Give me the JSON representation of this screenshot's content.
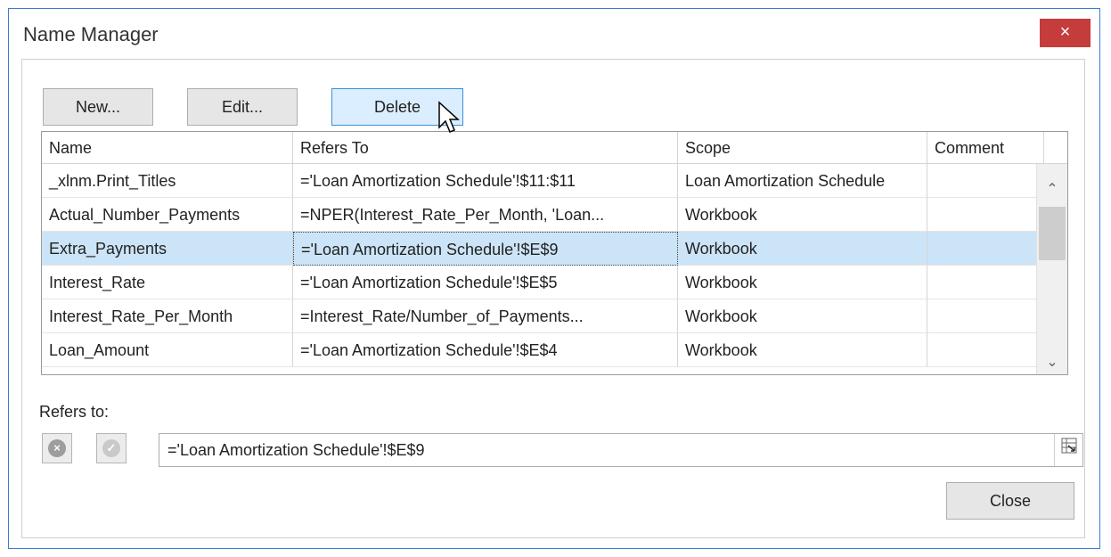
{
  "dialog": {
    "title": "Name Manager",
    "close_icon": "×"
  },
  "toolbar": {
    "new_label": "New...",
    "edit_label": "Edit...",
    "delete_label": "Delete"
  },
  "grid": {
    "headers": [
      "Name",
      "Refers To",
      "Scope",
      "Comment"
    ],
    "rows": [
      {
        "name": "_xlnm.Print_Titles",
        "refers": "='Loan Amortization Schedule'!$11:$11",
        "scope": "Loan Amortization Schedule",
        "comment": ""
      },
      {
        "name": "Actual_Number_Payments",
        "refers": "=NPER(Interest_Rate_Per_Month, 'Loan...",
        "scope": "Workbook",
        "comment": ""
      },
      {
        "name": "Extra_Payments",
        "refers": "='Loan Amortization Schedule'!$E$9",
        "scope": "Workbook",
        "comment": ""
      },
      {
        "name": "Interest_Rate",
        "refers": "='Loan Amortization Schedule'!$E$5",
        "scope": "Workbook",
        "comment": ""
      },
      {
        "name": "Interest_Rate_Per_Month",
        "refers": "=Interest_Rate/Number_of_Payments...",
        "scope": "Workbook",
        "comment": ""
      },
      {
        "name": "Loan_Amount",
        "refers": "='Loan Amortization Schedule'!$E$4",
        "scope": "Workbook",
        "comment": ""
      }
    ],
    "selected_row": 2
  },
  "refers": {
    "label": "Refers to:",
    "value": "='Loan Amortization Schedule'!$E$9",
    "cancel_icon": "×",
    "confirm_icon": "✓"
  },
  "footer": {
    "close_label": "Close"
  },
  "colors": {
    "accent": "#3a7bd5",
    "selection": "#cce4f7",
    "close": "#c43c3c"
  }
}
